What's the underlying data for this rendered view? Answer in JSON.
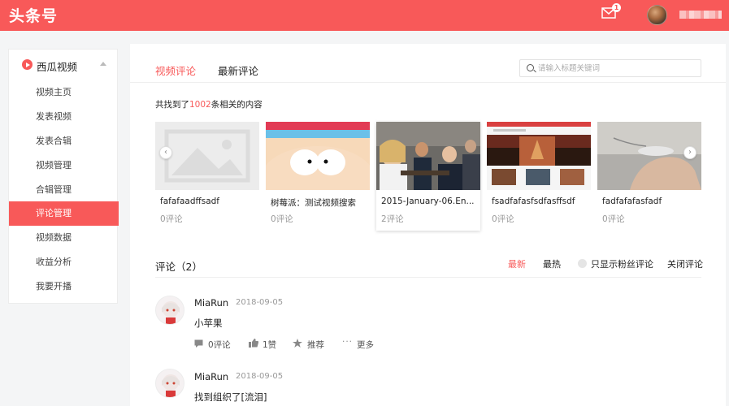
{
  "header": {
    "logo": "头条号",
    "mail_badge": "1",
    "brand_color": "#f85959"
  },
  "sidebar": {
    "section_title": "西瓜视频",
    "items": [
      {
        "label": "视频主页"
      },
      {
        "label": "发表视频"
      },
      {
        "label": "发表合辑"
      },
      {
        "label": "视频管理"
      },
      {
        "label": "合辑管理"
      },
      {
        "label": "评论管理",
        "active": true
      },
      {
        "label": "视频数据"
      },
      {
        "label": "收益分析"
      },
      {
        "label": "我要开播"
      }
    ]
  },
  "tabs": [
    {
      "label": "视频评论",
      "active": true
    },
    {
      "label": "最新评论"
    }
  ],
  "search": {
    "placeholder": "请输入标题关键词"
  },
  "found": {
    "prefix": "共找到了",
    "count": "1002",
    "suffix": "条相关的内容"
  },
  "videos": [
    {
      "title": "fafafaadffsadf",
      "comments": "0评论",
      "thumb": "placeholder-image"
    },
    {
      "title": "树莓派：测试视频搜索",
      "comments": "0评论",
      "thumb": "cartoon-face"
    },
    {
      "title": "2015-January-06.En...",
      "comments": "2评论",
      "thumb": "meeting-photo",
      "selected": true
    },
    {
      "title": "fsadfafasfsdfasffsdf",
      "comments": "0评论",
      "thumb": "website-screenshot"
    },
    {
      "title": "fadfafafasfadf",
      "comments": "0评论",
      "thumb": "hand-photo"
    }
  ],
  "comments_section": {
    "title": "评论（2）",
    "filters": {
      "latest": "最新",
      "hot": "最热",
      "fans_only": "只显示粉丝评论",
      "close": "关闭评论"
    }
  },
  "comments": [
    {
      "user": "MiaRun",
      "date": "2018-09-05",
      "text": "小苹果",
      "replies": "0评论",
      "likes": "1赞",
      "recommend": "推荐",
      "more": "更多"
    },
    {
      "user": "MiaRun",
      "date": "2018-09-05",
      "text": "找到组织了[流泪]"
    }
  ]
}
